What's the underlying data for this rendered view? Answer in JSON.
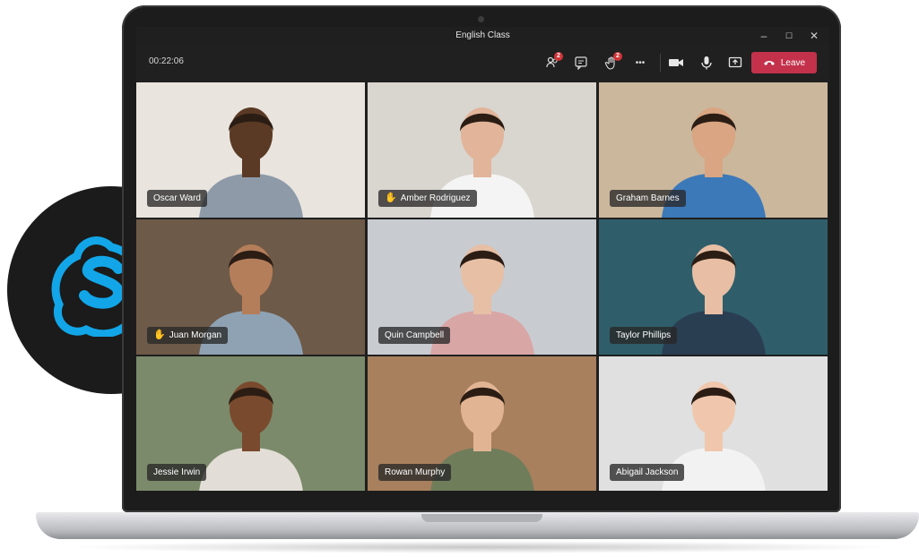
{
  "window": {
    "title": "English Class",
    "controls": {
      "minimize": "–",
      "maximize": "☐",
      "close": "✕"
    }
  },
  "toolbar": {
    "timer": "00:22:06",
    "participants_badge": "2",
    "raise_hand_badge": "2",
    "more_label": "•••",
    "leave_label": "Leave"
  },
  "participants": [
    {
      "name": "Oscar Ward",
      "hand_raised": false,
      "active": false,
      "bg": "#e9e4de",
      "skin": "#5a3a25",
      "shirt": "#8e9aa8"
    },
    {
      "name": "Amber Rodriguez",
      "hand_raised": true,
      "active": true,
      "bg": "#d9d5cf",
      "skin": "#e2b49a",
      "shirt": "#f4f4f4"
    },
    {
      "name": "Graham Barnes",
      "hand_raised": false,
      "active": false,
      "bg": "#cbb79c",
      "skin": "#d9a582",
      "shirt": "#3c79b9"
    },
    {
      "name": "Juan Morgan",
      "hand_raised": true,
      "active": true,
      "bg": "#6e5a48",
      "skin": "#b57e5b",
      "shirt": "#8ea2b3"
    },
    {
      "name": "Quin Campbell",
      "hand_raised": false,
      "active": false,
      "bg": "#c8ccd1",
      "skin": "#e6bfa5",
      "shirt": "#d9a6a6"
    },
    {
      "name": "Taylor Phillips",
      "hand_raised": false,
      "active": false,
      "bg": "#2f5e6a",
      "skin": "#e8bfa4",
      "shirt": "#2a3e52"
    },
    {
      "name": "Jessie Irwin",
      "hand_raised": false,
      "active": false,
      "bg": "#7b8a6a",
      "skin": "#7a4a2e",
      "shirt": "#e2ddd6"
    },
    {
      "name": "Rowan Murphy",
      "hand_raised": false,
      "active": false,
      "bg": "#a8805e",
      "skin": "#e1b494",
      "shirt": "#707d5b"
    },
    {
      "name": "Abigail Jackson",
      "hand_raised": false,
      "active": false,
      "bg": "#dfe0df",
      "skin": "#f0c7ad",
      "shirt": "#f2f2f2"
    }
  ],
  "colors": {
    "accent_leave": "#c4314b",
    "active_border": "#f2b31a",
    "skype_blue": "#12a6e8"
  },
  "icons": [
    "participants-icon",
    "chat-icon",
    "raise-hand-icon",
    "more-icon",
    "camera-icon",
    "mic-icon",
    "share-screen-icon",
    "phone-hangup-icon",
    "skype-logo-icon"
  ]
}
